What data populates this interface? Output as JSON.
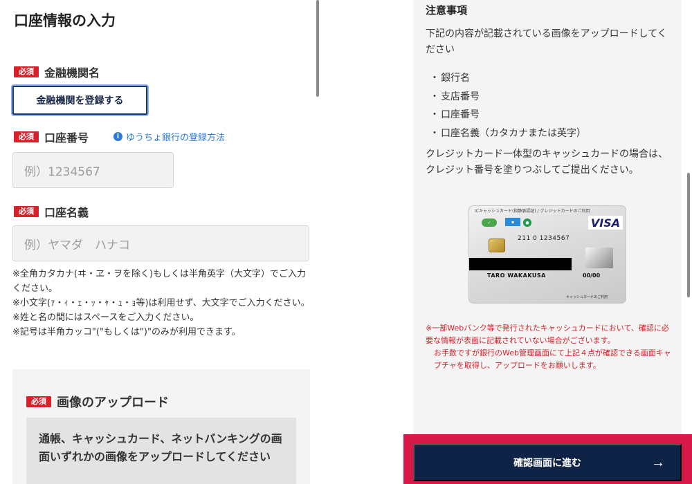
{
  "form": {
    "title": "口座情報の入力",
    "required_badge": "必須",
    "bank": {
      "label": "金融機関名",
      "button_label": "金融機関を登録する"
    },
    "account_number": {
      "label": "口座番号",
      "help_link": "ゆうちょ銀行の登録方法",
      "placeholder": "例）1234567"
    },
    "account_name": {
      "label": "口座名義",
      "placeholder": "例）ヤマダ　ハナコ"
    },
    "notes": [
      "※全角カタカナ(ヰ・ヱ・ヲを除く)もしくは半角英字（大文字）でご入力ください。",
      "※小文字(ｧ・ｨ・ｪ・ｯ・ｬ・ｭ・ｮ等)は利用せず、大文字でご入力ください。",
      "※姓と名の間にはスペースをご入力ください。",
      "※記号は半角カッコ\"(\"もしくは\")\"のみが利用できます。"
    ],
    "upload": {
      "title": "画像のアップロード",
      "description": "通帳、キャッシュカード、ネットバンキングの画面いずれかの画像をアップロードしてください"
    }
  },
  "notice": {
    "title": "注意事項",
    "intro": "下記の内容が記載されている画像をアップロードしてください",
    "items": [
      "銀行名",
      "支店番号",
      "口座番号",
      "口座名義（カタカナまたは英字）"
    ],
    "card_note": "クレジットカード一体型のキャッシュカードの場合は、クレジット番号を塗りつぶしてご提出ください。",
    "card": {
      "top_text": "ICキャッシュカード(指静脈認証) / クレジットカードのご利用",
      "brand": "VISA",
      "number": "211 0 1234567",
      "name": "TARO WAKAKUSA",
      "expiry": "00/00",
      "bottom_text": "キャッシュカードのご利用"
    },
    "warning_lines": [
      "※一部Webバンク等で発行されたキャッシュカードにおいて、確認に必要な情報が表面に記載されていない場合がございます。",
      "お手数ですが銀行のWeb管理画面にて上記４点が確認できる画面キャプチャを取得し、アップロードをお願いします。"
    ]
  },
  "footer": {
    "next_label": "確認画面に進む",
    "next_arrow": "→"
  },
  "colors": {
    "required": "#d7222b",
    "link": "#2a7ad6",
    "primary": "#0f2346",
    "highlight": "#d9184a"
  }
}
